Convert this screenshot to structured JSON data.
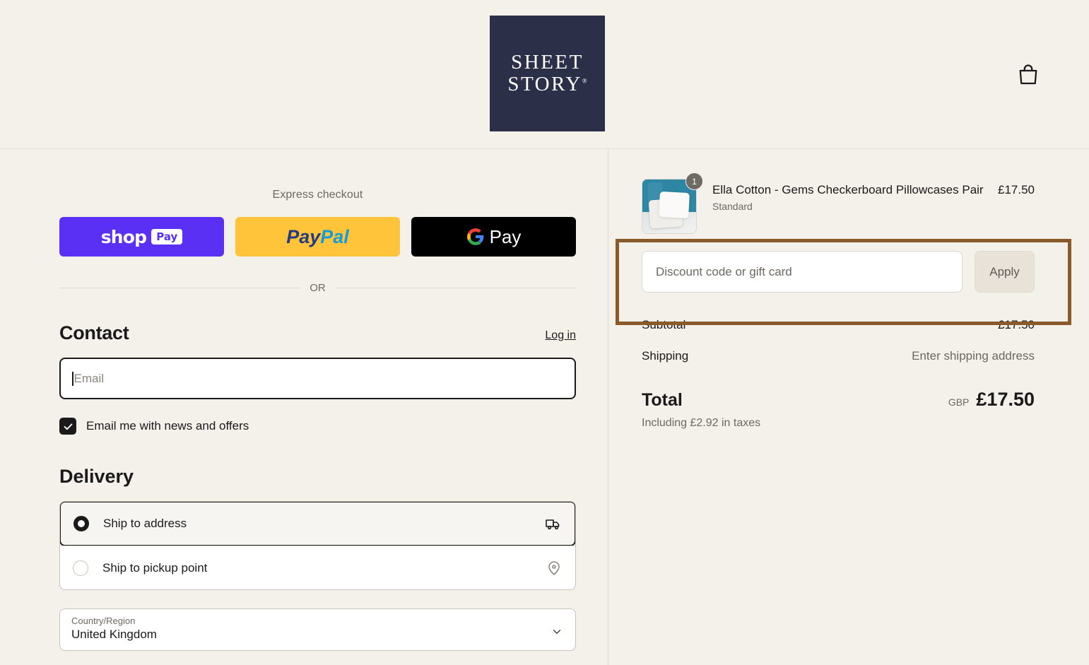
{
  "header": {
    "logo_line1": "SHEET",
    "logo_line2": "STORY",
    "logo_reg": "®",
    "cart_icon": "shopping-bag-icon"
  },
  "express": {
    "title": "Express checkout",
    "buttons": [
      {
        "id": "shop-pay",
        "label": "shop",
        "badge": "Pay",
        "color": "#5A31F4"
      },
      {
        "id": "paypal",
        "label_a": "Pay",
        "label_b": "Pal",
        "color": "#FFC439"
      },
      {
        "id": "google-pay",
        "label": "Pay",
        "color": "#000000"
      }
    ],
    "divider_text": "OR"
  },
  "contact": {
    "title": "Contact",
    "login_label": "Log in",
    "email_placeholder": "Email",
    "email_value": "",
    "newsletter_label": "Email me with news and offers",
    "newsletter_checked": true,
    "check_glyph": "✓"
  },
  "delivery": {
    "title": "Delivery",
    "options": [
      {
        "label": "Ship to address",
        "selected": true,
        "icon": "truck-icon"
      },
      {
        "label": "Ship to pickup point",
        "selected": false,
        "icon": "map-pin-icon"
      }
    ],
    "country": {
      "label": "Country/Region",
      "value": "United Kingdom",
      "chevron": "chevron-down-icon"
    }
  },
  "summary": {
    "line_item": {
      "name": "Ella Cotton - Gems Checkerboard Pillowcases Pair",
      "variant": "Standard",
      "price": "£17.50",
      "quantity": "1"
    },
    "discount": {
      "placeholder": "Discount code or gift card",
      "value": "",
      "apply_label": "Apply",
      "highlight_color": "#8A5A2B"
    },
    "rows": [
      {
        "label": "Subtotal",
        "value": "£17.50",
        "muted": false
      },
      {
        "label": "Shipping",
        "value": "Enter shipping address",
        "muted": true
      }
    ],
    "total": {
      "label": "Total",
      "currency": "GBP",
      "amount": "£17.50",
      "tax_note": "Including £2.92 in taxes"
    }
  }
}
